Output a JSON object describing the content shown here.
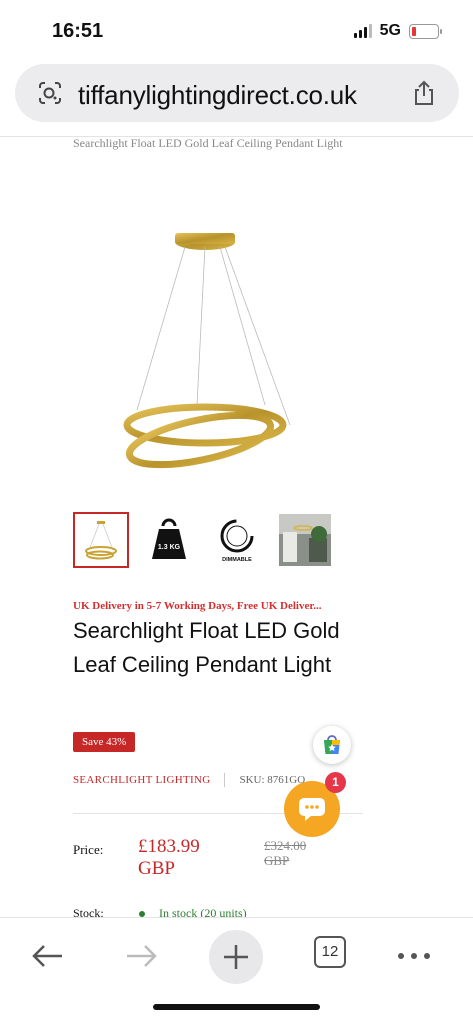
{
  "status_bar": {
    "time": "16:51",
    "network": "5G",
    "battery_color": "#e53935"
  },
  "browser": {
    "url": "tiffanylightingdirect.co.uk"
  },
  "breadcrumb": "Searchlight Float LED Gold Leaf Ceiling Pendant Light",
  "thumbnails": [
    {
      "name": "product-photo",
      "label": ""
    },
    {
      "name": "weight",
      "label": "1.3 KG"
    },
    {
      "name": "dimmable",
      "label": "DIMMABLE"
    },
    {
      "name": "room-photo",
      "label": ""
    }
  ],
  "product": {
    "delivery_note": "UK Delivery in 5-7 Working Days, Free UK Deliver...",
    "title": "Searchlight Float LED Gold Leaf Ceiling Pendant Light",
    "save_badge": "Save 43%",
    "brand": "SEARCHLIGHT LIGHTING",
    "sku": "SKU: 8761GO",
    "price_label": "Price:",
    "price_amount": "£183.99",
    "price_currency": "GBP",
    "old_price_amount": "£324.00",
    "old_price_currency": "GBP",
    "stock_label": "Stock:",
    "stock_value": "In stock (20 units)"
  },
  "chat": {
    "badge_count": "1"
  },
  "bottom_nav": {
    "tab_count": "12"
  },
  "colors": {
    "accent_red": "#c62828",
    "chat_orange": "#f5a623",
    "stock_green": "#2e7d32",
    "gold": "#c9a233"
  }
}
